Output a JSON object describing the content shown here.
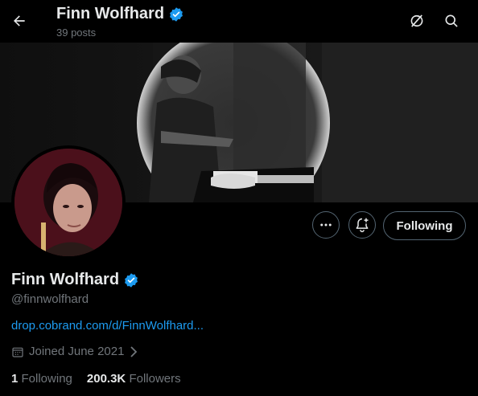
{
  "header": {
    "name": "Finn Wolfhard",
    "post_count": "39 posts"
  },
  "profile": {
    "name": "Finn Wolfhard",
    "handle": "@finnwolfhard",
    "link": "drop.cobrand.com/d/FinnWolfhard...",
    "joined": "Joined June 2021",
    "following_count": "1",
    "following_label": "Following",
    "followers_count": "200.3K",
    "followers_label": "Followers"
  },
  "actions": {
    "following_button": "Following"
  },
  "colors": {
    "background": "#000000",
    "text_primary": "#e7e9ea",
    "text_secondary": "#71767b",
    "link": "#1d9bf0",
    "verified_badge": "#1d9bf0",
    "button_border": "#536471"
  },
  "icons": [
    "back-arrow-icon",
    "verified-badge-icon",
    "refresh-icon",
    "search-icon",
    "more-icon",
    "notification-add-icon",
    "calendar-icon",
    "chevron-right-icon"
  ]
}
